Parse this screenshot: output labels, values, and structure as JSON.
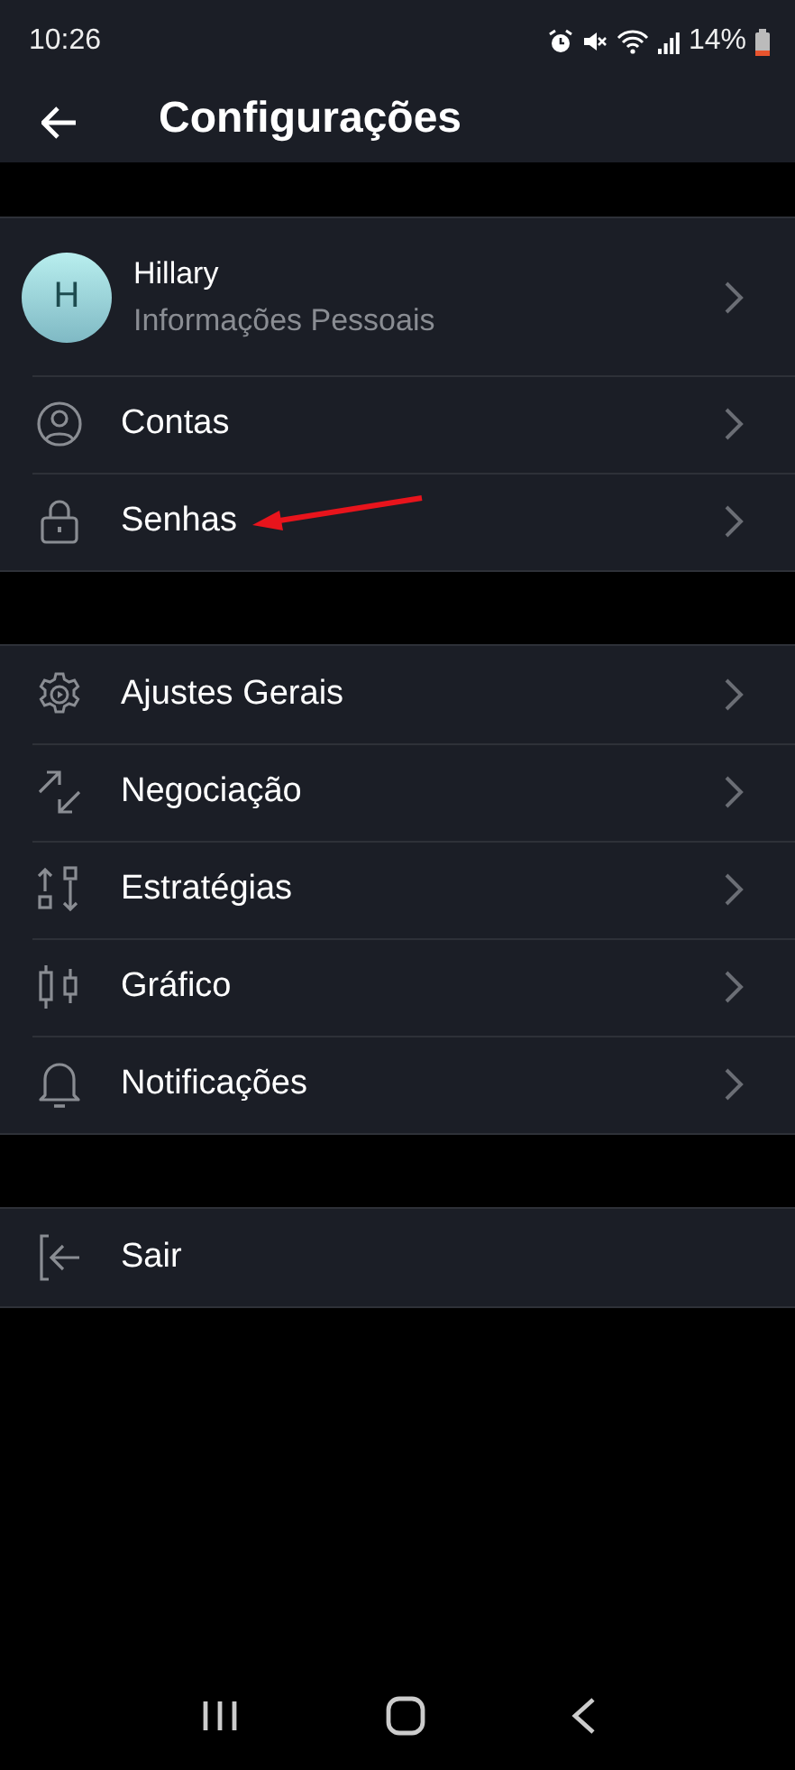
{
  "status_bar": {
    "time": "10:26",
    "battery": "14%"
  },
  "header": {
    "title": "Configurações"
  },
  "profile": {
    "initial": "H",
    "name": "Hillary",
    "subtitle": "Informações Pessoais"
  },
  "groups": [
    {
      "items": [
        {
          "kind": "account",
          "label": "Contas"
        },
        {
          "kind": "lock",
          "label": "Senhas",
          "annotated": true
        }
      ]
    },
    {
      "items": [
        {
          "kind": "gear",
          "label": "Ajustes Gerais"
        },
        {
          "kind": "trade",
          "label": "Negociação"
        },
        {
          "kind": "strategy",
          "label": "Estratégias"
        },
        {
          "kind": "chart",
          "label": "Gráfico"
        },
        {
          "kind": "bell",
          "label": "Notificações"
        }
      ]
    },
    {
      "items": [
        {
          "kind": "logout",
          "label": "Sair"
        }
      ]
    }
  ]
}
